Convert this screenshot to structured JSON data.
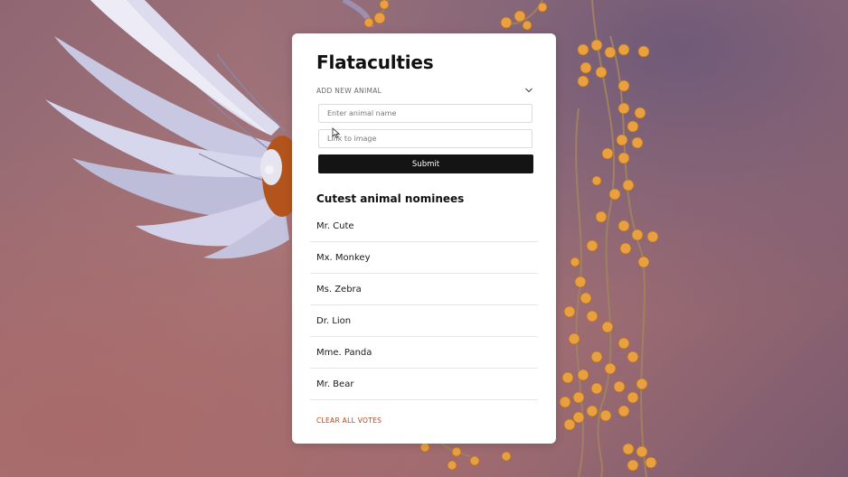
{
  "background": {
    "description_icon": "bird-photo"
  },
  "card": {
    "title": "Flataculties",
    "add_section": {
      "label": "ADD NEW ANIMAL",
      "toggle_icon": "chevron-down-icon"
    },
    "form": {
      "name_placeholder": "Enter animal name",
      "name_value": "",
      "image_placeholder": "Link to image",
      "image_value": "",
      "submit_label": "Submit"
    },
    "list_heading": "Cutest animal nominees",
    "nominees": [
      "Mr. Cute",
      "Mx. Monkey",
      "Ms. Zebra",
      "Dr. Lion",
      "Mme. Panda",
      "Mr. Bear"
    ],
    "clear_label": "CLEAR ALL VOTES"
  },
  "colors": {
    "button_bg": "#141414",
    "clear_link": "#b5451b",
    "berry": "#e8a040"
  }
}
